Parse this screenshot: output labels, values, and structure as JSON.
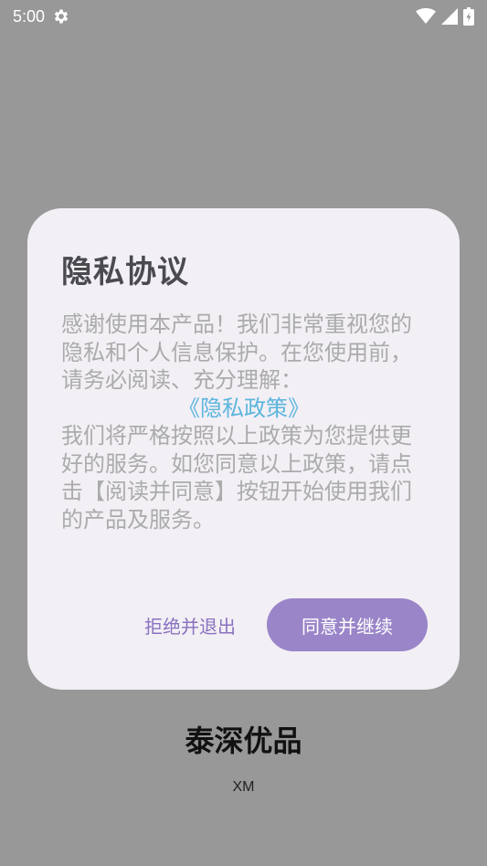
{
  "status_bar": {
    "time": "5:00",
    "icons": [
      "gear-icon",
      "wifi-icon",
      "cellular-signal-icon",
      "battery-charging-icon"
    ]
  },
  "app": {
    "name": "泰深优品",
    "subtitle": "XM"
  },
  "dialog": {
    "title": "隐私协议",
    "intro": "感谢使用本产品！我们非常重视您的隐私和个人信息保护。在您使用前，请务必阅读、充分理解：",
    "policy_link": "《隐私政策》",
    "outro": "我们将严格按照以上政策为您提供更好的服务。如您同意以上政策，请点击【阅读并同意】按钮开始使用我们的产品及服务。",
    "reject_label": "拒绝并退出",
    "agree_label": "同意并继续"
  },
  "colors": {
    "overlay": "#989898",
    "dialog_bg": "#f2eff5",
    "accent": "#9a85c9",
    "link": "#5bb5dd",
    "body_text": "#ababab"
  }
}
